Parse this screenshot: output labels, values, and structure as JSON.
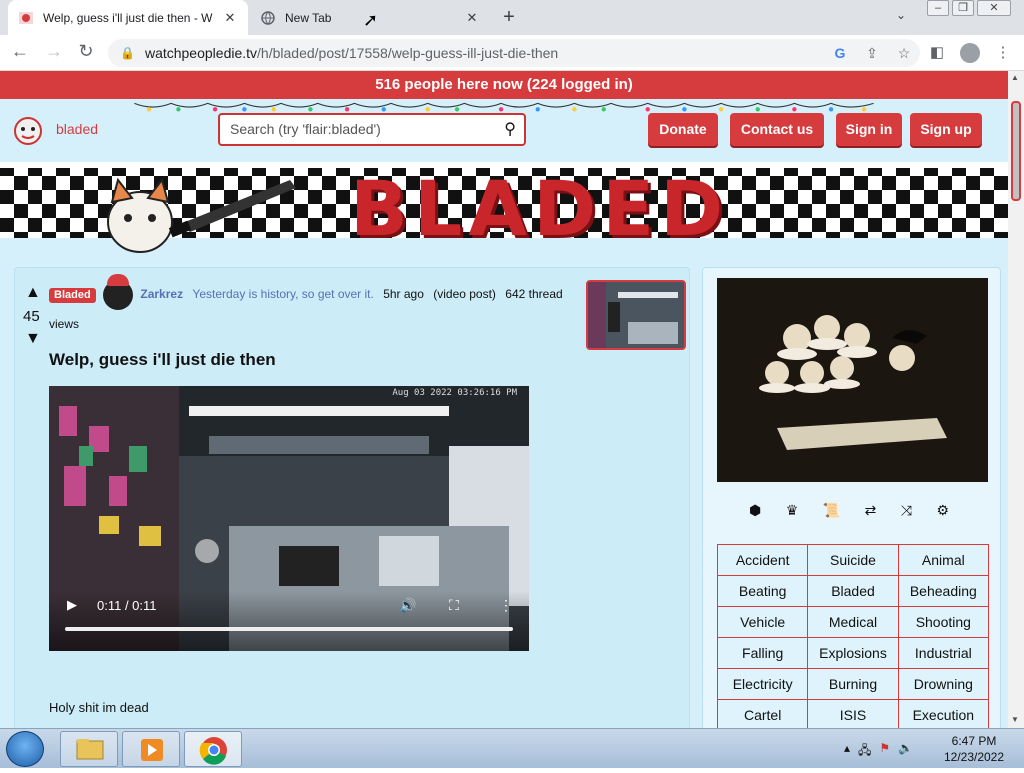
{
  "browser": {
    "tabs": [
      {
        "title": "Welp, guess i'll just die then - W",
        "close": "✕"
      },
      {
        "title": "New Tab",
        "close": "✕"
      }
    ],
    "new_tab": "+",
    "url_host": "watchpeopledie.tv",
    "url_path": "/h/bladed/post/17558/welp-guess-ill-just-die-then"
  },
  "site": {
    "online_banner": "516 people here now (224 logged in)",
    "hole_name": "bladed",
    "search_placeholder": "Search (try 'flair:bladed')",
    "buttons": {
      "donate": "Donate",
      "contact": "Contact us",
      "sign_in": "Sign in",
      "sign_up": "Sign up"
    },
    "hero_title": "BLADED"
  },
  "post": {
    "score": "45",
    "flair": "Bladed",
    "author": "Zarkrez",
    "author_bio": "Yesterday is history, so get over it.",
    "time_ago": "5hr ago",
    "post_kind": "(video post)",
    "views": "642 thread views",
    "title": "Welp, guess i'll just die then",
    "video": {
      "timestamp": "Aug 03 2022  03:26:16 PM",
      "time": "0:11 / 0:11"
    },
    "body": "Holy shit im dead"
  },
  "sidebar": {
    "categories": [
      [
        "Accident",
        "Suicide",
        "Animal"
      ],
      [
        "Beating",
        "Bladed",
        "Beheading"
      ],
      [
        "Vehicle",
        "Medical",
        "Shooting"
      ],
      [
        "Falling",
        "Explosions",
        "Industrial"
      ],
      [
        "Electricity",
        "Burning",
        "Drowning"
      ],
      [
        "Cartel",
        "ISIS",
        "Execution"
      ]
    ]
  },
  "taskbar": {
    "time": "6:47 PM",
    "date": "12/23/2022"
  },
  "colors": {
    "accent": "#d63b3e",
    "page_bg": "#d6f0fb",
    "link": "#5b6fb5"
  }
}
